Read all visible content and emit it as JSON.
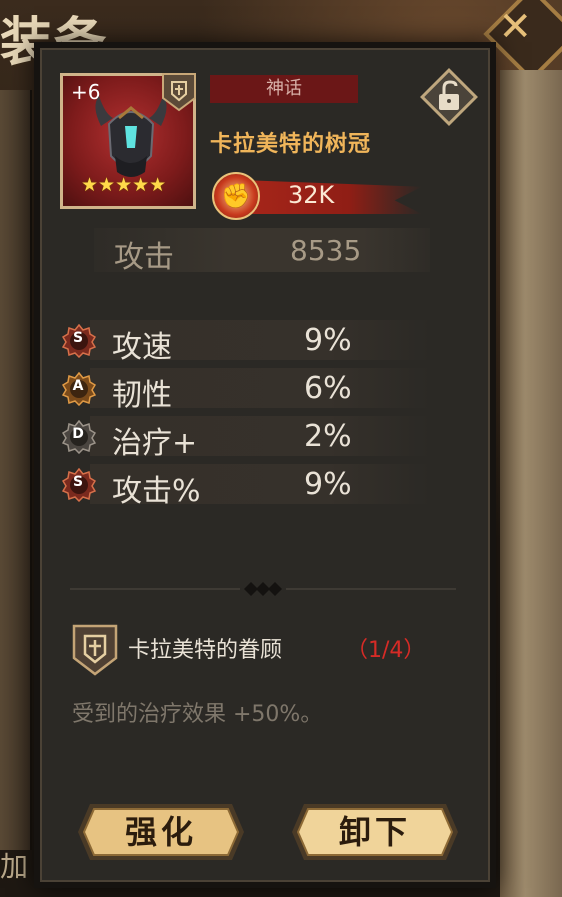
{
  "background": {
    "title": "装备",
    "close_icon": "x-icon",
    "bottom_text": "加"
  },
  "item": {
    "level": "+6",
    "stars": "★★★★★",
    "star_count": 5,
    "rarity": "神话",
    "name": "卡拉美特的树冠",
    "power": "32K",
    "lock_icon": "unlocked-padlock-icon",
    "power_icon": "fist-icon"
  },
  "main_stat": {
    "name": "攻击",
    "value": "8535"
  },
  "sub_stats": [
    {
      "grade": "S",
      "name": "攻速",
      "value": "9%"
    },
    {
      "grade": "A",
      "name": "韧性",
      "value": "6%"
    },
    {
      "grade": "D",
      "name": "治疗+",
      "value": "2%"
    },
    {
      "grade": "S",
      "name": "攻击%",
      "value": "9%"
    }
  ],
  "set": {
    "name": "卡拉美特的眷顾",
    "progress": "（1/4）",
    "description": "受到的治疗效果 +50%。",
    "icon": "shield-cross-icon"
  },
  "buttons": {
    "enhance": "强化",
    "unequip": "卸下"
  },
  "colors": {
    "rarity_bg": "#6b1717",
    "item_name": "#f0b55a",
    "set_progress": "#d62b26",
    "button_gold": "#e7c382"
  }
}
